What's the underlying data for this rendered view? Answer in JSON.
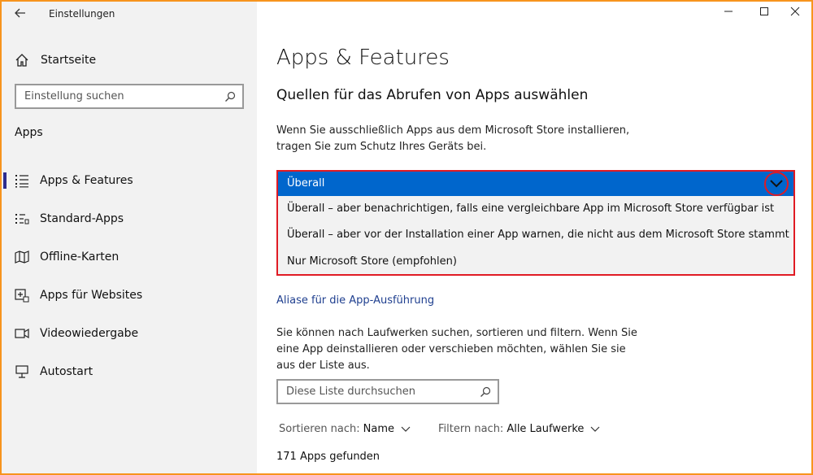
{
  "window": {
    "title": "Einstellungen",
    "controls": [
      "minimize",
      "maximize",
      "close"
    ]
  },
  "sidebar": {
    "home_label": "Startseite",
    "search_placeholder": "Einstellung suchen",
    "section_title": "Apps",
    "items": [
      {
        "label": "Apps & Features",
        "icon": "apps-list-icon",
        "active": true
      },
      {
        "label": "Standard-Apps",
        "icon": "default-apps-icon",
        "active": false
      },
      {
        "label": "Offline-Karten",
        "icon": "map-icon",
        "active": false
      },
      {
        "label": "Apps für Websites",
        "icon": "web-apps-icon",
        "active": false
      },
      {
        "label": "Videowiedergabe",
        "icon": "video-icon",
        "active": false
      },
      {
        "label": "Autostart",
        "icon": "startup-icon",
        "active": false
      }
    ]
  },
  "main": {
    "title": "Apps & Features",
    "subheading": "Quellen für das Abrufen von Apps auswählen",
    "description_line1": "Wenn Sie ausschließlich Apps aus dem Microsoft Store installieren,",
    "description_line2": "tragen Sie zum Schutz Ihres Geräts bei.",
    "dropdown": {
      "selected": "Überall",
      "options": [
        "Überall – aber benachrichtigen, falls eine vergleichbare App im Microsoft Store verfügbar ist",
        "Überall – aber vor der Installation einer App warnen, die nicht aus dem Microsoft Store stammt",
        "Nur Microsoft Store (empfohlen)"
      ]
    },
    "alias_link": "Aliase für die App-Ausführung",
    "list_text_line1": "Sie können nach Laufwerken suchen, sortieren und filtern. Wenn Sie",
    "list_text_line2": "eine App deinstallieren oder verschieben möchten, wählen Sie sie",
    "list_text_line3": "aus der Liste aus.",
    "list_search_placeholder": "Diese Liste durchsuchen",
    "sort_label": "Sortieren nach:",
    "sort_value": "Name",
    "filter_label": "Filtern nach:",
    "filter_value": "Alle Laufwerke",
    "count_text": "171 Apps gefunden"
  },
  "colors": {
    "accent": "#0066cc",
    "highlight_border": "#e01b24",
    "frame_border": "#f7941d",
    "sidebar_bg": "#f2f2f2",
    "link": "#1f3f8f"
  }
}
